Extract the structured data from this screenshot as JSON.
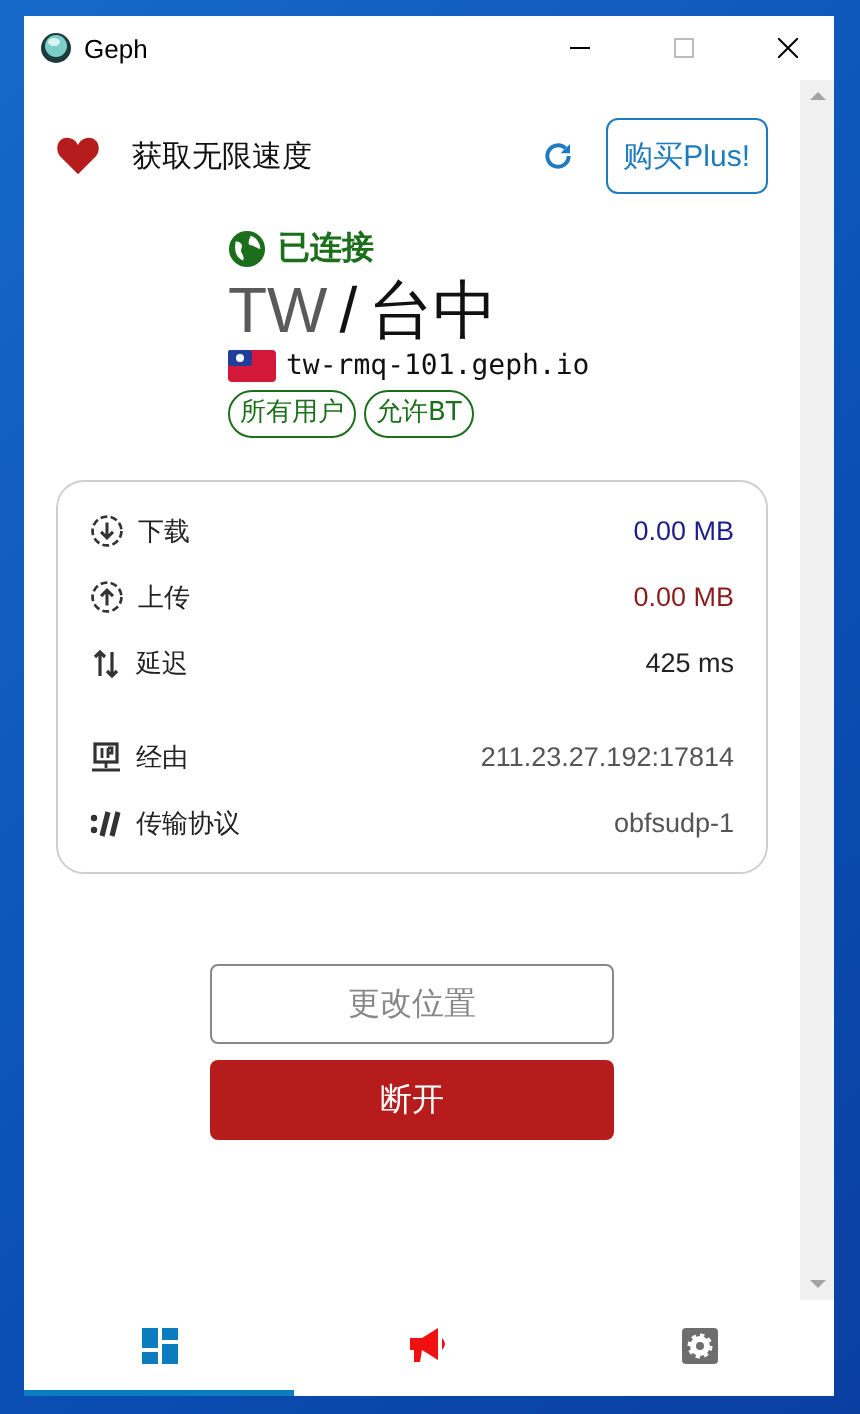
{
  "window": {
    "title": "Geph"
  },
  "promo": {
    "text": "获取无限速度",
    "button": "购买Plus!"
  },
  "connection": {
    "status": "已连接",
    "country": "TW",
    "separator": "/",
    "city": "台中",
    "server": "tw-rmq-101.geph.io",
    "tags": [
      "所有用户",
      "允许BT"
    ]
  },
  "stats": [
    {
      "kind": "download",
      "label": "下载",
      "value": "0.00 MB",
      "color": "#1c1c8c"
    },
    {
      "kind": "upload",
      "label": "上传",
      "value": "0.00 MB",
      "color": "#8c1c1c"
    },
    {
      "kind": "latency",
      "label": "延迟",
      "value": "425 ms",
      "color": "#222222"
    },
    {
      "kind": "route",
      "label": "经由",
      "value": "211.23.27.192:17814",
      "color": "#555555"
    },
    {
      "kind": "protocol",
      "label": "传输协议",
      "value": "obfsudp-1",
      "color": "#555555"
    }
  ],
  "buttons": {
    "change": "更改位置",
    "disconnect": "断开"
  },
  "tabs": [
    {
      "kind": "dashboard",
      "selected": true
    },
    {
      "kind": "news",
      "selected": false
    },
    {
      "kind": "settings",
      "selected": false
    }
  ]
}
